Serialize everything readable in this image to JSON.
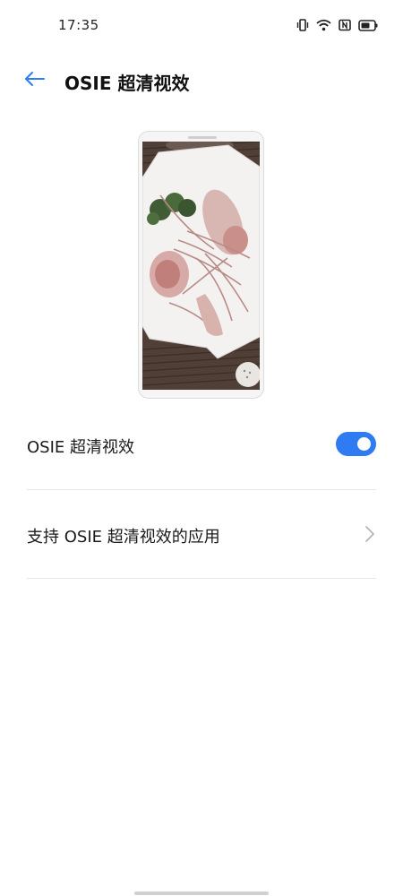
{
  "status_bar": {
    "time": "17:35",
    "icons": [
      "vibrate-icon",
      "wifi-icon",
      "nfc-icon",
      "battery-icon"
    ]
  },
  "header": {
    "back_icon": "arrow-left-icon",
    "title": "OSIE 超清视效"
  },
  "preview": {
    "icon": "phone-preview-image",
    "description_hidden": ""
  },
  "settings": {
    "toggle_label": "OSIE 超清视效",
    "toggle_on": true,
    "apps_label": "支持 OSIE 超清视效的应用",
    "apps_icon": "chevron-right-icon"
  },
  "colors": {
    "accent": "#2f7bf2",
    "back_arrow": "#2f7bf2",
    "divider": "#e6e6e6"
  }
}
